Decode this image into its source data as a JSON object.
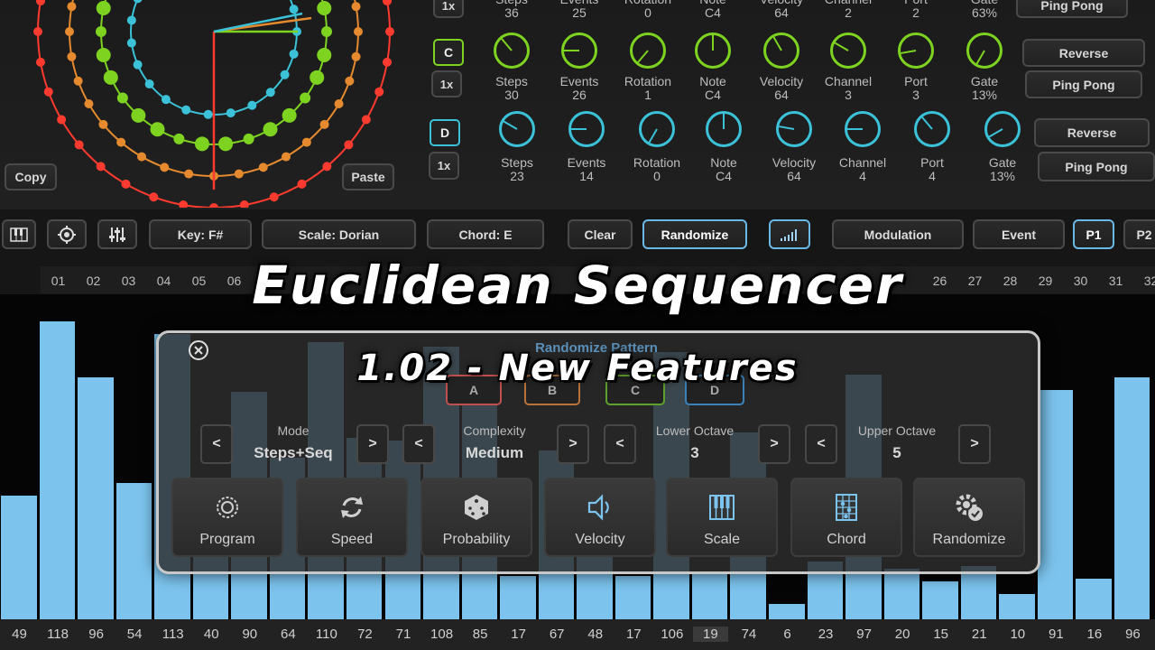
{
  "sequencer": {
    "rows": [
      {
        "id": "B",
        "color": "#e58a2e",
        "speed": "1x",
        "labels": [
          "Steps",
          "Events",
          "Rotation",
          "Note",
          "Velocity",
          "Channel",
          "Port",
          "Gate"
        ],
        "values": [
          "36",
          "25",
          "0",
          "C4",
          "64",
          "2",
          "2",
          "63%"
        ],
        "buttons": [
          "Ping Pong"
        ]
      },
      {
        "id": "C",
        "color": "#7ed321",
        "speed": "1x",
        "labels": [
          "Steps",
          "Events",
          "Rotation",
          "Note",
          "Velocity",
          "Channel",
          "Port",
          "Gate"
        ],
        "values": [
          "30",
          "26",
          "1",
          "C4",
          "64",
          "3",
          "3",
          "13%"
        ],
        "buttons": [
          "Reverse",
          "Ping Pong"
        ]
      },
      {
        "id": "D",
        "color": "#3bc2d8",
        "speed": "1x",
        "labels": [
          "Steps",
          "Events",
          "Rotation",
          "Note",
          "Velocity",
          "Channel",
          "Port",
          "Gate"
        ],
        "values": [
          "23",
          "14",
          "0",
          "C4",
          "64",
          "4",
          "4",
          "13%"
        ],
        "buttons": [
          "Reverse",
          "Ping Pong"
        ]
      }
    ],
    "copy_label": "Copy",
    "paste_label": "Paste",
    "track_a_label": "A"
  },
  "toolbar": {
    "key": "Key: F#",
    "scale": "Scale: Dorian",
    "chord": "Chord: E",
    "clear": "Clear",
    "randomize": "Randomize",
    "modulation": "Modulation",
    "event": "Event",
    "p1": "P1",
    "p2": "P2",
    "icons": [
      "piano-icon",
      "target-icon",
      "sliders-icon",
      "velocity-bars-icon"
    ]
  },
  "steps": [
    "01",
    "02",
    "03",
    "04",
    "05",
    "06",
    "26",
    "27",
    "28",
    "29",
    "30",
    "31",
    "32"
  ],
  "step_values": [
    "49",
    "118",
    "96",
    "54",
    "113",
    "40",
    "90",
    "64",
    "110",
    "72",
    "71",
    "108",
    "85",
    "17",
    "67",
    "48",
    "17",
    "106",
    "19",
    "74",
    "6",
    "23",
    "97",
    "20",
    "15",
    "21",
    "10",
    "91",
    "16",
    "96"
  ],
  "overlay": {
    "title": "Euclidean Sequencer",
    "subtitle": "1.02 - New Features"
  },
  "randomize_panel": {
    "heading": "Randomize Pattern",
    "track_buttons": [
      "A",
      "B",
      "C",
      "D"
    ],
    "selectors": [
      {
        "title": "Mode",
        "value": "Steps+Seq"
      },
      {
        "title": "Complexity",
        "value": "Medium"
      },
      {
        "title": "Lower Octave",
        "value": "3"
      },
      {
        "title": "Upper Octave",
        "value": "5"
      }
    ],
    "prev_arrow": "<",
    "next_arrow": ">",
    "actions": [
      {
        "label": "Program",
        "icon": "program-icon"
      },
      {
        "label": "Speed",
        "icon": "refresh-icon"
      },
      {
        "label": "Probability",
        "icon": "dice-icon"
      },
      {
        "label": "Velocity",
        "icon": "speaker-icon"
      },
      {
        "label": "Scale",
        "icon": "piano-icon"
      },
      {
        "label": "Chord",
        "icon": "chord-grid-icon"
      },
      {
        "label": "Randomize",
        "icon": "gear-check-icon"
      }
    ],
    "close_icon": "close-icon"
  },
  "colors": {
    "accent": "#6ab8e8",
    "bar": "#7cc4ee",
    "trackA": "#ff3b30",
    "trackB": "#e58a2e",
    "trackC": "#7ed321",
    "trackD": "#3bc2d8"
  }
}
